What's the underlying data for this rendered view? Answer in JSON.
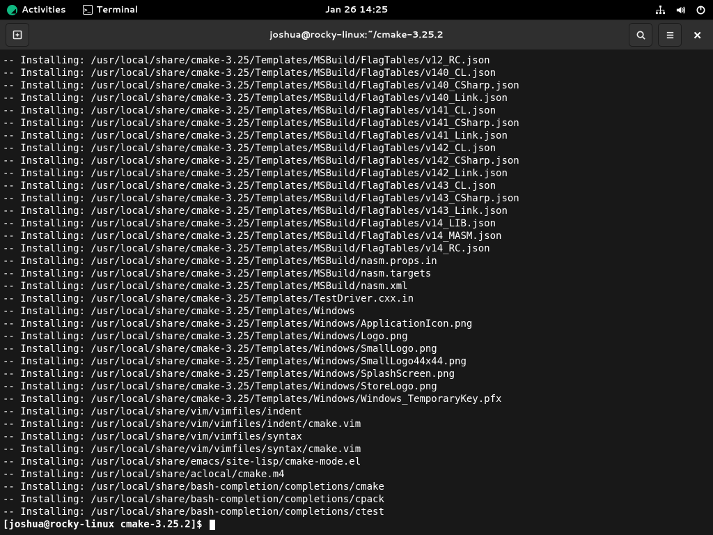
{
  "topbar": {
    "activities": "Activities",
    "terminal_label": "Terminal",
    "datetime": "Jan 26  14:25"
  },
  "headerbar": {
    "title": "joshua@rocky-linux:~/cmake-3.25.2"
  },
  "terminal": {
    "prefix": "-- Installing: ",
    "base_path": "/usr/local/share/",
    "files": [
      "cmake-3.25/Templates/MSBuild/FlagTables/v12_RC.json",
      "cmake-3.25/Templates/MSBuild/FlagTables/v140_CL.json",
      "cmake-3.25/Templates/MSBuild/FlagTables/v140_CSharp.json",
      "cmake-3.25/Templates/MSBuild/FlagTables/v140_Link.json",
      "cmake-3.25/Templates/MSBuild/FlagTables/v141_CL.json",
      "cmake-3.25/Templates/MSBuild/FlagTables/v141_CSharp.json",
      "cmake-3.25/Templates/MSBuild/FlagTables/v141_Link.json",
      "cmake-3.25/Templates/MSBuild/FlagTables/v142_CL.json",
      "cmake-3.25/Templates/MSBuild/FlagTables/v142_CSharp.json",
      "cmake-3.25/Templates/MSBuild/FlagTables/v142_Link.json",
      "cmake-3.25/Templates/MSBuild/FlagTables/v143_CL.json",
      "cmake-3.25/Templates/MSBuild/FlagTables/v143_CSharp.json",
      "cmake-3.25/Templates/MSBuild/FlagTables/v143_Link.json",
      "cmake-3.25/Templates/MSBuild/FlagTables/v14_LIB.json",
      "cmake-3.25/Templates/MSBuild/FlagTables/v14_MASM.json",
      "cmake-3.25/Templates/MSBuild/FlagTables/v14_RC.json",
      "cmake-3.25/Templates/MSBuild/nasm.props.in",
      "cmake-3.25/Templates/MSBuild/nasm.targets",
      "cmake-3.25/Templates/MSBuild/nasm.xml",
      "cmake-3.25/Templates/TestDriver.cxx.in",
      "cmake-3.25/Templates/Windows",
      "cmake-3.25/Templates/Windows/ApplicationIcon.png",
      "cmake-3.25/Templates/Windows/Logo.png",
      "cmake-3.25/Templates/Windows/SmallLogo.png",
      "cmake-3.25/Templates/Windows/SmallLogo44x44.png",
      "cmake-3.25/Templates/Windows/SplashScreen.png",
      "cmake-3.25/Templates/Windows/StoreLogo.png",
      "cmake-3.25/Templates/Windows/Windows_TemporaryKey.pfx",
      "vim/vimfiles/indent",
      "vim/vimfiles/indent/cmake.vim",
      "vim/vimfiles/syntax",
      "vim/vimfiles/syntax/cmake.vim",
      "emacs/site-lisp/cmake-mode.el",
      "aclocal/cmake.m4",
      "bash-completion/completions/cmake",
      "bash-completion/completions/cpack",
      "bash-completion/completions/ctest"
    ],
    "prompt": "[joshua@rocky-linux cmake-3.25.2]$ "
  }
}
